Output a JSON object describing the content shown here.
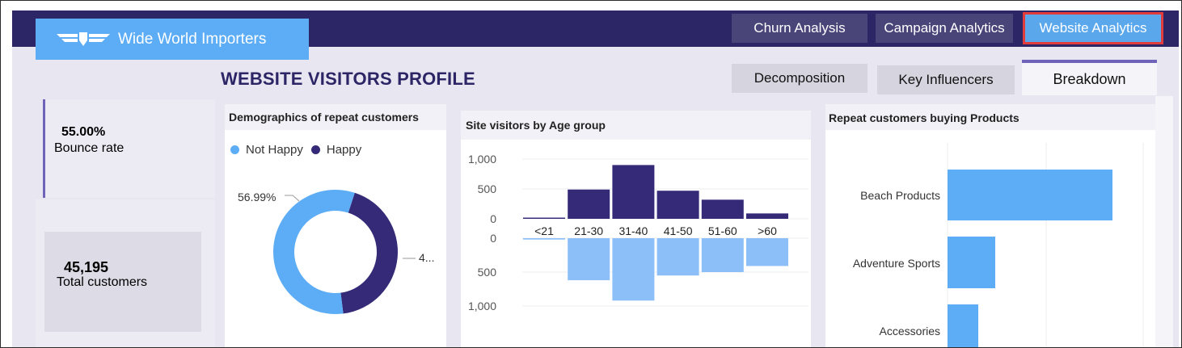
{
  "app": {
    "brand": "Wide World Importers",
    "logo_icon": "winged-shield-icon",
    "colors": {
      "navbar": "#2c2566",
      "accent": "#5dadf6",
      "highlight": "#e23b3b"
    }
  },
  "nav": {
    "churn": "Churn Analysis",
    "campaign": "Campaign Analytics",
    "website": "Website Analytics",
    "active": "Website Analytics"
  },
  "page": {
    "title": "WEBSITE VISITORS PROFILE"
  },
  "subnav": {
    "decomposition": "Decomposition",
    "key_influencers": "Key Influencers",
    "breakdown": "Breakdown",
    "active": "Breakdown"
  },
  "kpis": {
    "bounce": {
      "value": "55.00%",
      "label": "Bounce rate"
    },
    "customers": {
      "value": "45,195",
      "label": "Total customers"
    }
  },
  "donut": {
    "title": "Demographics of repeat customers",
    "legend": [
      {
        "name": "Not Happy",
        "color": "#5dadf6"
      },
      {
        "name": "Happy",
        "color": "#342a78"
      }
    ],
    "label_not_happy": "56.99%",
    "label_happy": "4..."
  },
  "age": {
    "title": "Site visitors by Age group",
    "top_ticks": [
      "1,000",
      "500",
      "0"
    ],
    "bottom_ticks": [
      "0",
      "500",
      "1,000"
    ]
  },
  "products": {
    "title": "Repeat customers buying Products"
  },
  "chart_data": [
    {
      "type": "pie",
      "title": "Demographics of repeat customers",
      "categories": [
        "Not Happy",
        "Happy"
      ],
      "values": [
        56.99,
        43.01
      ]
    },
    {
      "type": "bar",
      "title": "Site visitors by Age group",
      "categories": [
        "<21",
        "21-30",
        "31-40",
        "41-50",
        "51-60",
        ">60"
      ],
      "series": [
        {
          "name": "",
          "color": "#342a78",
          "values": [
            20,
            490,
            900,
            470,
            320,
            90
          ]
        },
        {
          "name": "",
          "color": "#8cbff7",
          "values": [
            20,
            620,
            920,
            550,
            500,
            410
          ]
        }
      ],
      "ylim": [
        0,
        1000
      ]
    },
    {
      "type": "bar",
      "title": "Repeat customers buying Products",
      "categories": [
        "Beach Products",
        "Adventure Sports",
        "Accessories"
      ],
      "values": [
        204,
        59,
        38
      ],
      "color": "#5dadf6"
    }
  ]
}
